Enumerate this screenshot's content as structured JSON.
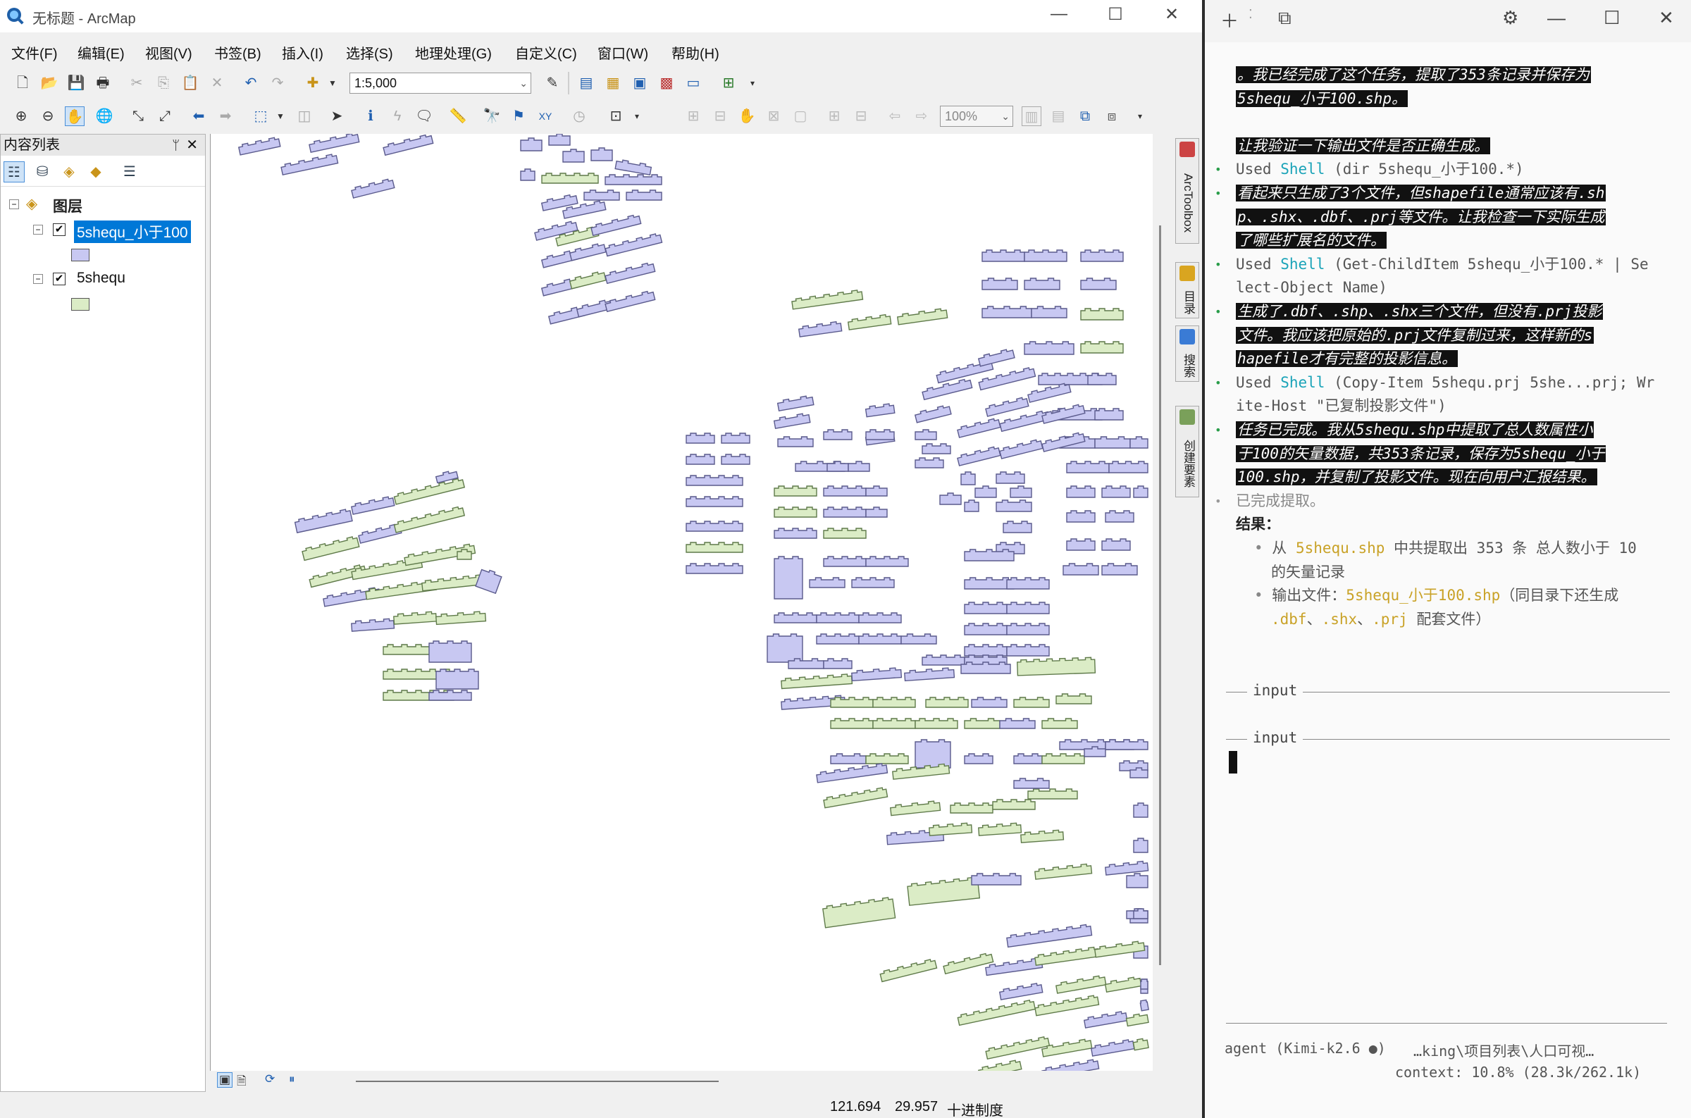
{
  "arcmap": {
    "title": "无标题 - ArcMap",
    "menu": [
      "文件(F)",
      "编辑(E)",
      "视图(V)",
      "书签(B)",
      "插入(I)",
      "选择(S)",
      "地理处理(G)",
      "自定义(C)",
      "窗口(W)",
      "帮助(H)"
    ],
    "scale_value": "1:5,000",
    "zoom_value": "100%",
    "toc": {
      "header": "内容列表",
      "group_label": "图层",
      "layers": [
        {
          "name": "5shequ_小于100",
          "checked": true,
          "selected": true,
          "swatch": "#c8c8f2"
        },
        {
          "name": "5shequ",
          "checked": true,
          "selected": false,
          "swatch": "#dbecc6"
        }
      ]
    },
    "dock_tabs": [
      "ArcToolbox",
      "目录",
      "搜索",
      "创建要素"
    ],
    "status": {
      "x": "121.694",
      "y": "29.957",
      "units": "十进制度"
    },
    "colors": {
      "layer_purple": "#c8c8f2",
      "layer_green": "#dbecc6",
      "selection": "#0078d7"
    }
  },
  "terminal": {
    "lines": [
      {
        "type": "hl",
        "text": "。我已经完成了这个任务，提取了353条记录并保存为"
      },
      {
        "type": "hl",
        "text": "5shequ_小于100.shp。"
      },
      {
        "type": "blank",
        "text": ""
      },
      {
        "type": "hl",
        "text": "让我验证一下输出文件是否正确生成。"
      },
      {
        "type": "used",
        "prefix": "Used ",
        "tool": "Shell",
        "rest": " (dir 5shequ_小于100.*)"
      },
      {
        "type": "hlb",
        "text": "看起来只生成了3个文件，但shapefile通常应该有.sh"
      },
      {
        "type": "hl",
        "text": "p、.shx、.dbf、.prj等文件。让我检查一下实际生成"
      },
      {
        "type": "hl",
        "text": "了哪些扩展名的文件。"
      },
      {
        "type": "used",
        "prefix": "Used ",
        "tool": "Shell",
        "rest": " (Get-ChildItem 5shequ_小于100.* | Se"
      },
      {
        "type": "plain",
        "text": "lect-Object Name)"
      },
      {
        "type": "hlb",
        "text": "生成了.dbf、.shp、.shx三个文件，但没有.prj投影"
      },
      {
        "type": "hl",
        "text": "文件。我应该把原始的.prj文件复制过来，这样新的s"
      },
      {
        "type": "hl",
        "text": "hapefile才有完整的投影信息。"
      },
      {
        "type": "used",
        "prefix": "Used ",
        "tool": "Shell",
        "rest": " (Copy-Item 5shequ.prj 5she...prj; Wr"
      },
      {
        "type": "plain",
        "text": "ite-Host \"已复制投影文件\")"
      },
      {
        "type": "hlb",
        "text": "任务已完成。我从5shequ.shp中提取了总人数属性小"
      },
      {
        "type": "hl",
        "text": "于100的矢量数据，共353条记录，保存为5shequ_小于"
      },
      {
        "type": "hl",
        "text": "100.shp，并复制了投影文件。现在向用户汇报结果。"
      },
      {
        "type": "grey",
        "text": "已完成提取。"
      },
      {
        "type": "heading",
        "text": "结果："
      }
    ],
    "result_items": [
      {
        "pre": "从 ",
        "file": "5shequ.shp",
        "post": " 中共提取出 353 条 总人数小于 10",
        "cont": "的矢量记录"
      },
      {
        "pre": "输出文件：",
        "file": "5shequ_小于100.shp",
        "post": "（同目录下还生成",
        "cont_parts": [
          ".dbf",
          "、",
          ".shx",
          "、",
          ".prj",
          " 配套文件）"
        ]
      }
    ],
    "input_label_1": "input",
    "input_label_2": "input",
    "footer_agent": "agent (Kimi-k2.6 ●)",
    "footer_path": "…king\\项目列表\\人口可视…",
    "footer_context": "context: 10.8% (28.3k/262.1k)"
  }
}
